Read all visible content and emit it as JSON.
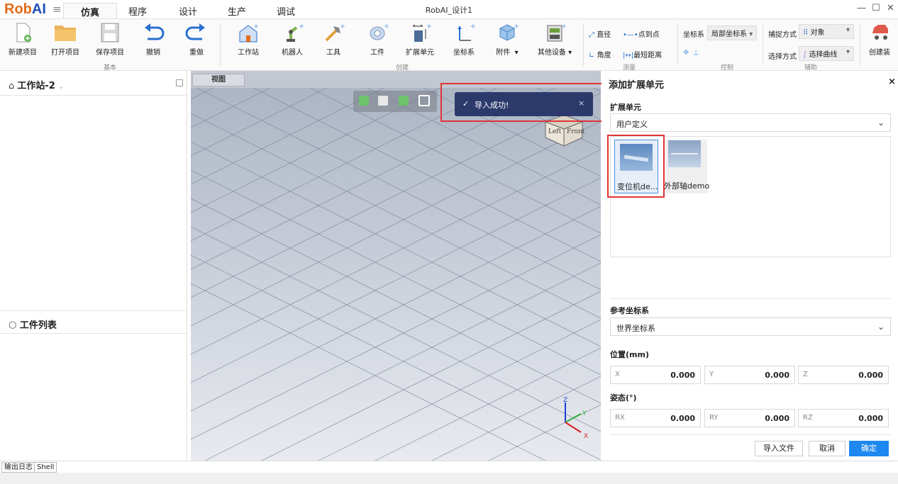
{
  "app": {
    "logo_rob": "Rob",
    "logo_ai": "AI",
    "window_title": "RobAI_设计1"
  },
  "menu_tabs": [
    {
      "label": "仿真",
      "active": true
    },
    {
      "label": "程序"
    },
    {
      "label": "设计"
    },
    {
      "label": "生产"
    },
    {
      "label": "调试"
    }
  ],
  "window_controls": {
    "min": "—",
    "max": "☐",
    "close": "✕"
  },
  "ribbon": {
    "basic": {
      "group": "基本",
      "new": "新建项目",
      "open": "打开项目",
      "save": "保存项目",
      "undo": "撤销",
      "redo": "重做"
    },
    "create": {
      "group": "创建",
      "station": "工作站",
      "robot": "机器人",
      "tool": "工具",
      "workpiece": "工件",
      "ext_unit": "扩展单元",
      "coord": "坐标系",
      "attach": "附件",
      "other": "其他设备"
    },
    "measure": {
      "group": "测量",
      "diameter": "直径",
      "p2p": "点到点",
      "angle": "角度",
      "shortest": "最短距离"
    },
    "control": {
      "group": "控制",
      "coord_label": "坐标系",
      "coord_value": "局部坐标系"
    },
    "assist": {
      "group": "辅助",
      "snap_label": "捕捉方式",
      "snap_value": "对象",
      "select_label": "选择方式",
      "select_value": "选择曲线",
      "create_asm": "创建装"
    }
  },
  "left_panel": {
    "station_title": "工作站-2",
    "workpiece_list": "工件列表"
  },
  "viewport": {
    "tab": "视图",
    "toast": "导入成功!",
    "cube_left": "Left",
    "cube_front": "Front",
    "axis_x": "X",
    "axis_y": "Y",
    "axis_z": "Z"
  },
  "right_panel": {
    "title": "添加扩展单元",
    "close": "×",
    "ext_unit_label": "扩展单元",
    "ext_unit_select": "用户定义",
    "items": [
      {
        "label": "变位机de..."
      },
      {
        "label": "外部轴demo"
      }
    ],
    "ref_coord_label": "参考坐标系",
    "ref_coord_select": "世界坐标系",
    "position_label": "位置(mm)",
    "pos": {
      "x_key": "X",
      "x": "0.000",
      "y_key": "Y",
      "y": "0.000",
      "z_key": "Z",
      "z": "0.000"
    },
    "orientation_label": "姿态(°)",
    "rot": {
      "rx_key": "RX",
      "rx": "0.000",
      "ry_key": "RY",
      "ry": "0.000",
      "rz_key": "RZ",
      "rz": "0.000"
    },
    "import_btn": "导入文件",
    "cancel_btn": "取消",
    "ok_btn": "确定"
  },
  "status_tabs": {
    "log": "输出日志",
    "shell": "Shell"
  }
}
